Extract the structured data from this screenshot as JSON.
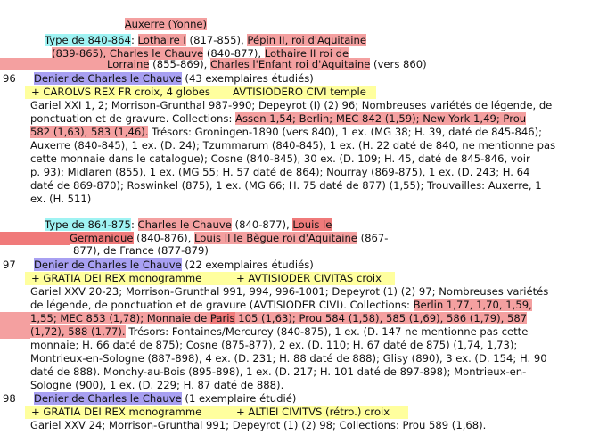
{
  "title": "Auxerre (Yonne)",
  "sections": [
    {
      "type_label": "Type de 840-864",
      "rulers_lines": [
        [
          "Lothaire I",
          " (817-855), ",
          "Pépin II, roi d'Aquitaine"
        ],
        [
          "(839-865), ",
          "Charles le Chauve",
          " (840-877), ",
          "Lothaire II roi de"
        ],
        [
          "Lorraine",
          " (855-869), ",
          "Charles l'Enfant roi d'Aquitaine",
          " (vers 860)"
        ]
      ],
      "entries": [
        {
          "number": "96",
          "coin_prefix": "Denier de ",
          "coin_ruler": "Charles le Chauve",
          "coin_count": " (43 exemplaires étudiés)",
          "legend_obverse": "+ CAROLVS REX FR croix, 4 globes",
          "legend_reverse": "AVTISIODERO CIVI temple",
          "refs": [
            "Gariel XXI 1, 2; Morrison-Grunthal 987-990; Depeyrot (I) (2) 96; Nombreuses variétés de légende, de",
            "ponctuation et de gravure. Collections: ",
            "Assen 1,54; Berlin; MEC 842 (1,59); New York 1,49; Prou",
            "582 (1,63), 583 (1,46).",
            " Trésors: Groningen-1890 (vers 840), 1 ex. (MG 38; H. 39, daté de 845-846);",
            "Auxerre (840-845), 1 ex. (D. 24); Tzummarum (840-845), 1 ex. (H. 22 daté de 840, ne mentionne pas",
            "cette monnaie dans le catalogue); Cosne (840-845), 30 ex. (D. 109; H. 45, daté de 845-846, voir",
            "p. 93); Midlaren (855), 1 ex. (MG 55; H. 57 daté de 864); Nourray (869-875), 1 ex. (D. 243; H. 64",
            "daté de 869-870); Roswinkel (875), 1 ex. (MG 66; H. 75 daté de 877) (1,55); Trouvailles: Auxerre, 1",
            "ex. (H. 511)"
          ]
        }
      ]
    },
    {
      "type_label": "Type de 864-875",
      "rulers_lines": [
        [
          "Charles le Chauve",
          " (840-877), ",
          "Louis le"
        ],
        [
          "Germanique",
          " (840-876), ",
          "Louis II le Bègue roi d'Aquitaine",
          " (867-"
        ],
        [
          "877), de France (877-879)"
        ]
      ],
      "entries": [
        {
          "number": "97",
          "coin_prefix": "Denier de ",
          "coin_ruler": "Charles le Chauve",
          "coin_count": " (22 exemplaires étudiés)",
          "legend_obverse": "+ GRATIA DEI REX monogramme",
          "legend_reverse": "+ AVTISIODER CIVITAS croix",
          "refs": [
            "Gariel XXV 20-23; Morrison-Grunthal 991, 994, 996-1001; Depeyrot (1) (2) 97; Nombreuses variétés",
            "de légende, de ponctuation et de gravure (AVTISIODER CIVI). Collections: ",
            "Berlin 1,77, 1,70, 1,59,",
            "1,55; MEC 853 (1,78); Monnaie de ",
            "Paris",
            " 105 (1,63); Prou 584 (1,58), 585 (1,69), 586 (1,79), 587",
            "(1,72), 588 (1,77).",
            " Trésors: Fontaines/Mercurey (840-875), 1 ex. (D. 147 ne mentionne pas cette",
            "monnaie; H. 66 daté de 875); Cosne (875-877), 2 ex. (D. 110; H. 67 daté de 875) (1,74, 1,73);",
            "Montrieux-en-Sologne (887-898), 4 ex. (D. 231; H. 88 daté de 888); Glisy (890), 3 ex. (D. 154; H. 90",
            "daté de 888). Monchy-au-Bois (895-898), 1 ex. (D. 217; H. 101 daté de 897-898); Montrieux-en-",
            "Sologne (900), 1 ex. (D. 229; H. 87 daté de 888)."
          ]
        },
        {
          "number": "98",
          "coin_prefix": "Denier de ",
          "coin_ruler": "Charles le Chauve",
          "coin_count": " (1 exemplaire étudié)",
          "legend_obverse": "+ GRATIA DEI REX monogramme",
          "legend_reverse": "+ ALTIEI CIVITVS (rétro.) croix",
          "refs": [
            "Gariel XXV 24; Morrison-Grunthal 991; Depeyrot (1) (2) 98; Collections: Prou 589 (1,68)."
          ]
        }
      ]
    }
  ],
  "colors": {
    "pink": "#f4a0a0",
    "red": "#f07a7a",
    "cyan": "#9ff3f3",
    "purple": "#a8a0f2",
    "yellow": "#ffff9e"
  }
}
